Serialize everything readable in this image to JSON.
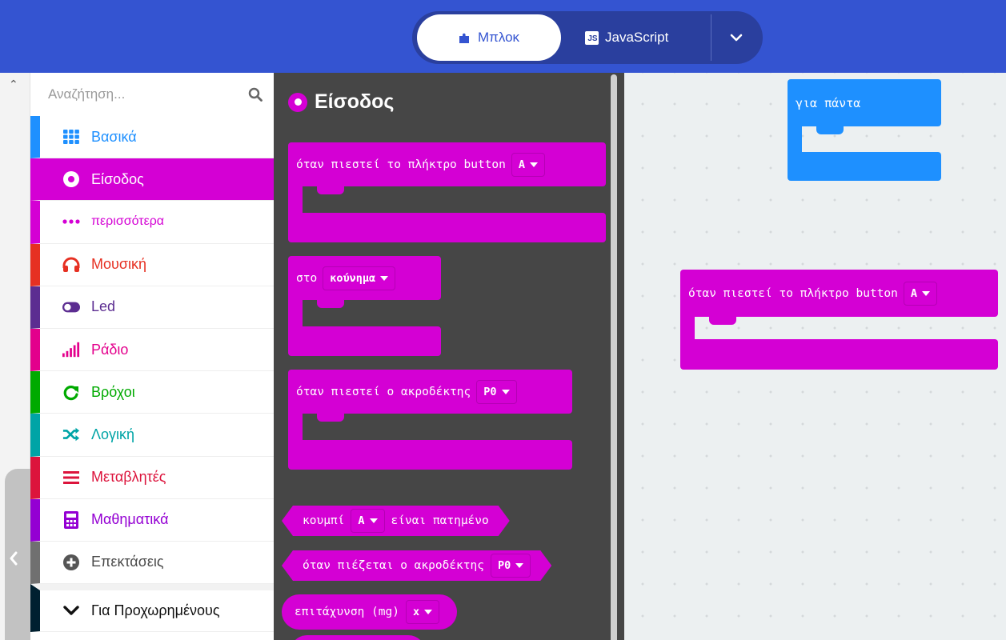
{
  "header": {
    "blocks_tab_label": "Μπλοκ",
    "js_tab_label": "JavaScript",
    "js_badge": "JS"
  },
  "toolbox": {
    "search_placeholder": "Αναζήτηση...",
    "categories": [
      {
        "label": "Βασικά",
        "color": "#1e90ff",
        "icon": "grid-icon"
      },
      {
        "label": "Είσοδος",
        "color": "#d400d4",
        "icon": "radio-button-icon",
        "selected": true
      },
      {
        "label": "περισσότερα",
        "color": "#d400d4",
        "icon": "dots-icon"
      },
      {
        "label": "Μουσική",
        "color": "#e63022",
        "icon": "headphones-icon"
      },
      {
        "label": "Led",
        "color": "#5c2d91",
        "icon": "toggle-icon"
      },
      {
        "label": "Ράδιο",
        "color": "#e3008c",
        "icon": "signal-bars-icon"
      },
      {
        "label": "Βρόχοι",
        "color": "#00aa00",
        "icon": "refresh-icon"
      },
      {
        "label": "Λογική",
        "color": "#00a4a6",
        "icon": "shuffle-icon"
      },
      {
        "label": "Μεταβλητές",
        "color": "#dc143c",
        "icon": "list-icon"
      },
      {
        "label": "Μαθηματικά",
        "color": "#9400d3",
        "icon": "calculator-icon"
      },
      {
        "label": "Επεκτάσεις",
        "color": "#707070",
        "icon": "plus-circle-icon"
      },
      {
        "label": "Για Προχωρημένους",
        "color": "#002030",
        "icon": "chevron-down-icon"
      }
    ]
  },
  "flyout": {
    "title": "Είσοδος",
    "accent": "#d400d4",
    "blocks": {
      "button_pressed": {
        "text": "όταν πιεστεί το πλήκτρο button",
        "dropdown": "A"
      },
      "on_gesture": {
        "text": "στο",
        "dropdown": "κούνημα"
      },
      "pin_pressed": {
        "text": "όταν πιεστεί ο ακροδέκτης",
        "dropdown": "P0"
      },
      "button_is_pressed": {
        "text_before": "κουμπί",
        "dropdown": "A",
        "text_after": "είναι πατημένο"
      },
      "pin_is_pressed": {
        "text": "όταν πιέζεται ο ακροδέκτης",
        "dropdown": "P0"
      },
      "acceleration": {
        "text": "επιτάχυνση (mg)",
        "dropdown": "x"
      }
    }
  },
  "workspace": {
    "forever_label": "για πάντα",
    "forever_color": "#1e90ff",
    "button_block": {
      "text": "όταν πιεστεί το πλήκτρο button",
      "dropdown": "A"
    }
  }
}
